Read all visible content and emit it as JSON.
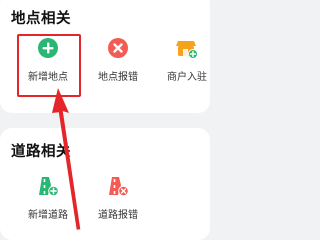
{
  "poi_section": {
    "title": "地点相关",
    "items": [
      {
        "label": "新增地点",
        "icon": "add-circle-icon",
        "color": "#2bb673"
      },
      {
        "label": "地点报错",
        "icon": "error-circle-icon",
        "color": "#f25c54"
      },
      {
        "label": "商户入驻",
        "icon": "shop-add-icon",
        "color": "#f7a21b"
      }
    ]
  },
  "road_section": {
    "title": "道路相关",
    "items": [
      {
        "label": "新增道路",
        "icon": "road-add-icon",
        "color": "#2bb673"
      },
      {
        "label": "道路报错",
        "icon": "road-error-icon",
        "color": "#f25c54"
      }
    ]
  },
  "annotation": {
    "highlight_color": "#e4262a"
  }
}
